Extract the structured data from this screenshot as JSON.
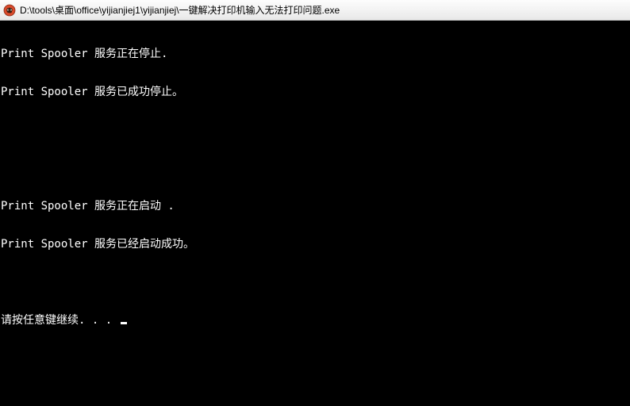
{
  "titlebar": {
    "icon_name": "app-icon",
    "title": "D:\\tools\\桌面\\office\\yijianjiej1\\yijianjiej\\一键解决打印机输入无法打印问题.exe"
  },
  "console": {
    "lines": [
      "Print Spooler 服务正在停止.",
      "Print Spooler 服务已成功停止。",
      "",
      "",
      "Print Spooler 服务正在启动 .",
      "Print Spooler 服务已经启动成功。",
      "",
      "请按任意键继续. . . "
    ]
  }
}
